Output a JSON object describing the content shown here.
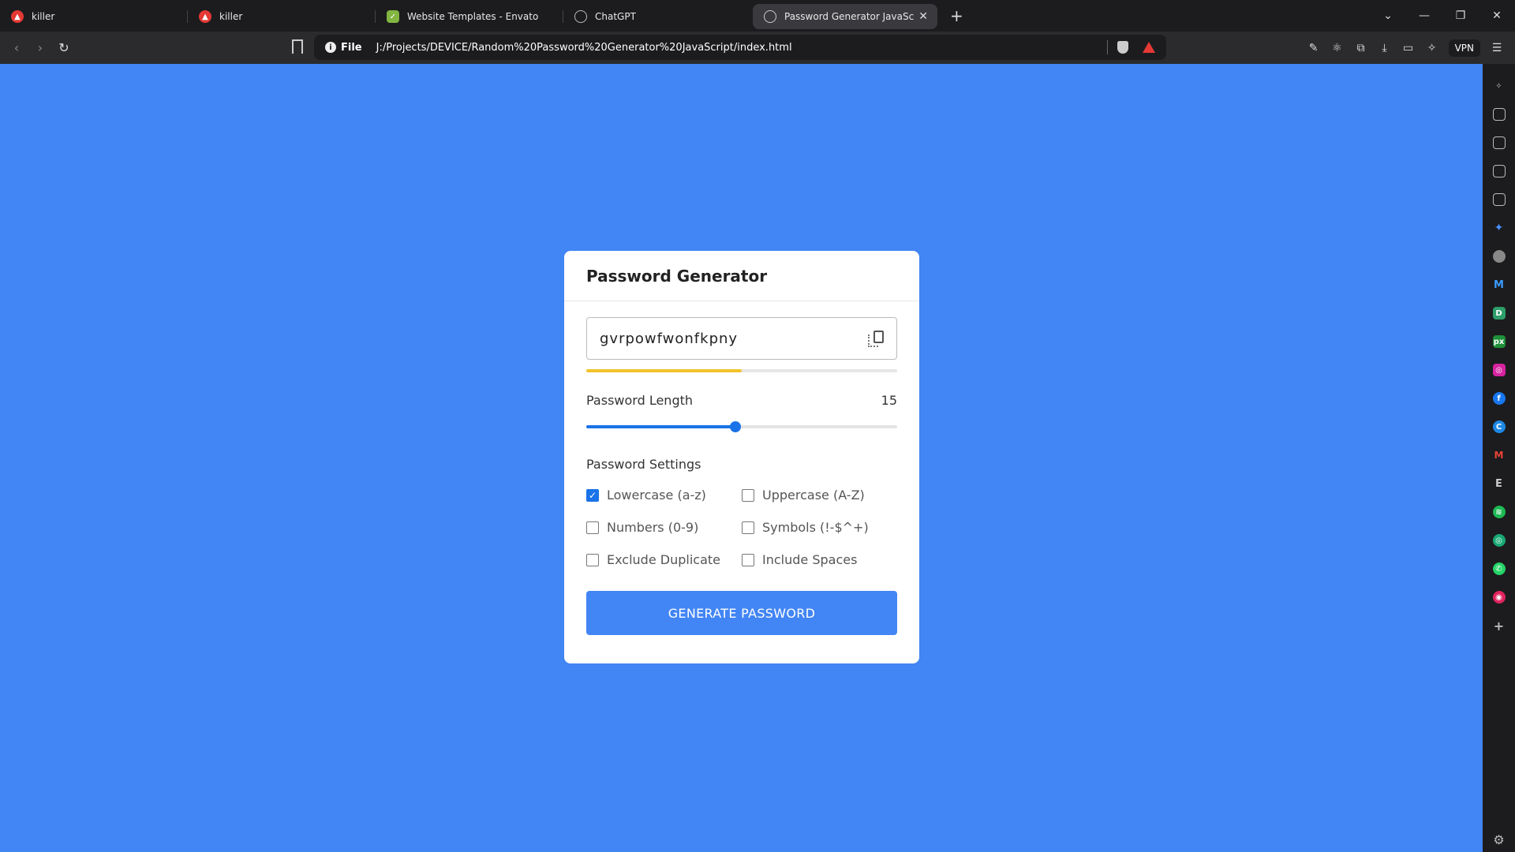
{
  "browser": {
    "tabs": [
      {
        "title": "killer",
        "favicon": "brave-lion-icon",
        "active": false
      },
      {
        "title": "killer",
        "favicon": "brave-lion-icon",
        "active": false
      },
      {
        "title": "Website Templates - Envato",
        "favicon": "envato-leaf-icon",
        "active": false
      },
      {
        "title": "ChatGPT",
        "favicon": "chatgpt-icon",
        "active": false
      },
      {
        "title": "Password Generator JavaScript",
        "favicon": "globe-icon",
        "active": true
      }
    ],
    "url_scheme": "File",
    "url": "J:/Projects/DEVICE/Random%20Password%20Generator%20JavaScript/index.html",
    "vpn_label": "VPN"
  },
  "app": {
    "title": "Password Generator",
    "password": "gvrpowfwonfkpny",
    "strength_fraction": 0.5,
    "strength_color": "#f2c32b",
    "length_label": "Password Length",
    "length_value": "15",
    "length_fraction": 0.48,
    "settings_label": "Password Settings",
    "options": [
      {
        "label": "Lowercase (a-z)",
        "checked": true
      },
      {
        "label": "Uppercase (A-Z)",
        "checked": false
      },
      {
        "label": "Numbers (0-9)",
        "checked": false
      },
      {
        "label": "Symbols (!-$^+)",
        "checked": false
      },
      {
        "label": "Exclude Duplicate",
        "checked": false
      },
      {
        "label": "Include Spaces",
        "checked": false
      }
    ],
    "generate_label": "GENERATE PASSWORD",
    "accent_color": "#4285f4"
  }
}
